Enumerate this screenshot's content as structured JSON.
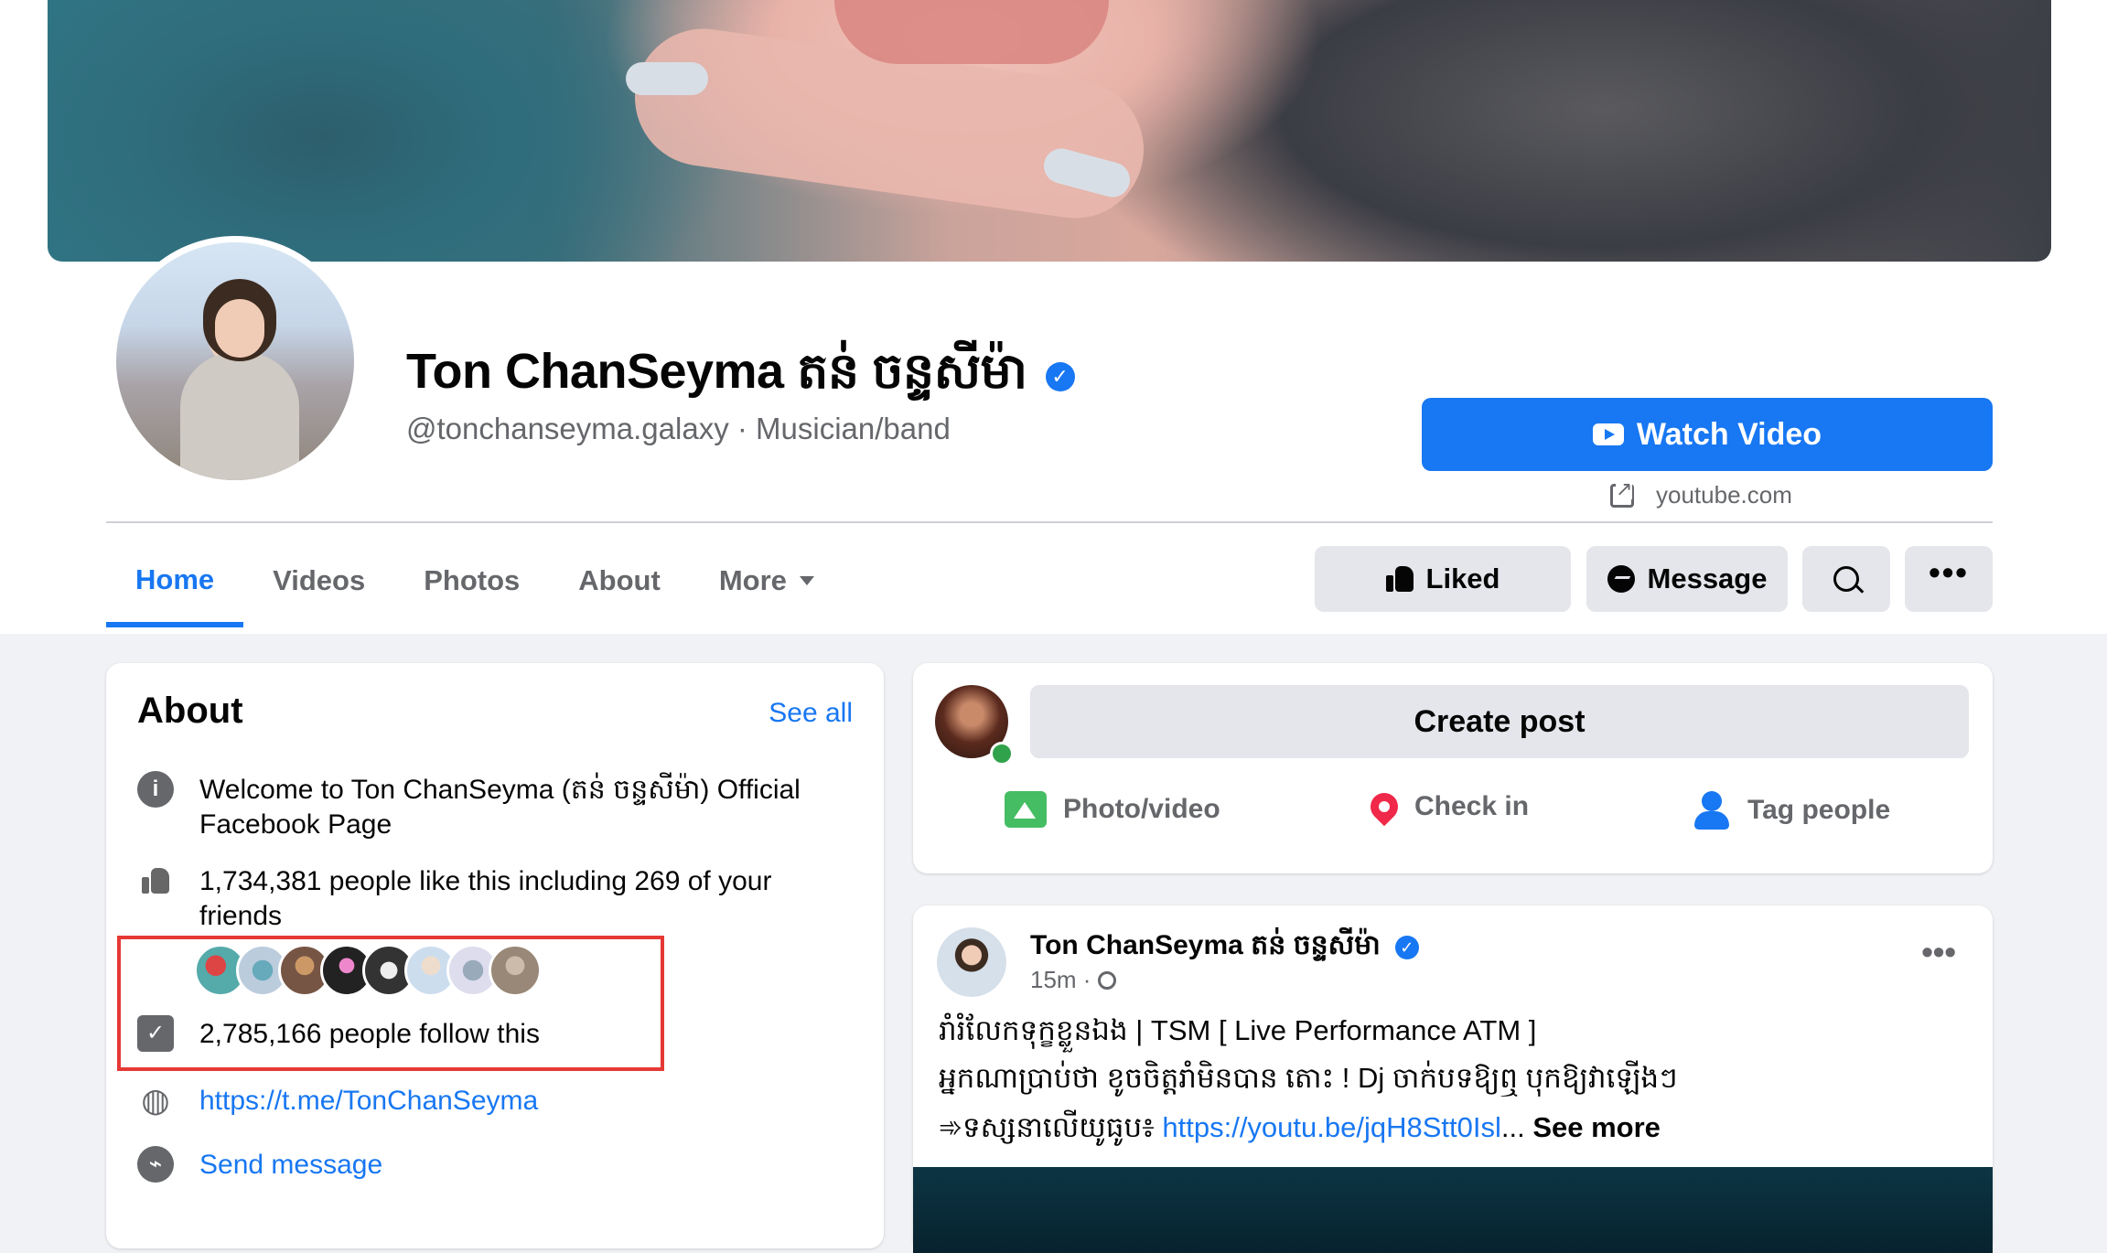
{
  "page": {
    "name": "Ton ChanSeyma តន់ ចន្ទសីម៉ា",
    "subtitle": "@tonchanseyma.galaxy · Musician/band",
    "verified_mark": "✓"
  },
  "cta": {
    "watch_label": "Watch Video",
    "external_site": "youtube.com"
  },
  "tabs": [
    {
      "label": "Home",
      "active": true
    },
    {
      "label": "Videos"
    },
    {
      "label": "Photos"
    },
    {
      "label": "About"
    },
    {
      "label": "More"
    }
  ],
  "actions": {
    "liked_label": "Liked",
    "message_label": "Message",
    "more_dots": "•••"
  },
  "about": {
    "title": "About",
    "see_all": "See all",
    "description": "Welcome to Ton ChanSeyma (តន់ ចន្ទសីម៉ា) Official Facebook Page",
    "likes": "1,734,381 people like this including 269 of your friends",
    "follows": "2,785,166 people follow this",
    "link": "https://t.me/TonChanSeyma",
    "send_message": "Send message",
    "info_icon": "i",
    "highlight_color": "#e53935"
  },
  "composer": {
    "create_post": "Create post",
    "photo_video": "Photo/video",
    "check_in": "Check in",
    "tag_people": "Tag people"
  },
  "post": {
    "author": "Ton ChanSeyma តន់ ចន្ទសីម៉ា",
    "time": "15m ·",
    "line1": "រាំរំលែកទុក្ខខ្លួនឯង | TSM [ Live Performance ATM ]",
    "line2": "អ្នកណាប្រាប់ថា ខូចចិត្តរាំមិនបាន តោះ ! Dj ចាក់បទឱ្យឮ បុកឱ្យវាឡើងៗ",
    "line3_prefix": "➾ទស្សនាលើយូធូប៖ ",
    "line3_link": "https://youtu.be/jqH8Stt0Isl",
    "line3_ellipsis": "... ",
    "see_more": "See more",
    "more_dots": "•••"
  },
  "colors": {
    "accent": "#1877f2",
    "background": "#f0f2f5",
    "secondary_text": "#65676b"
  }
}
